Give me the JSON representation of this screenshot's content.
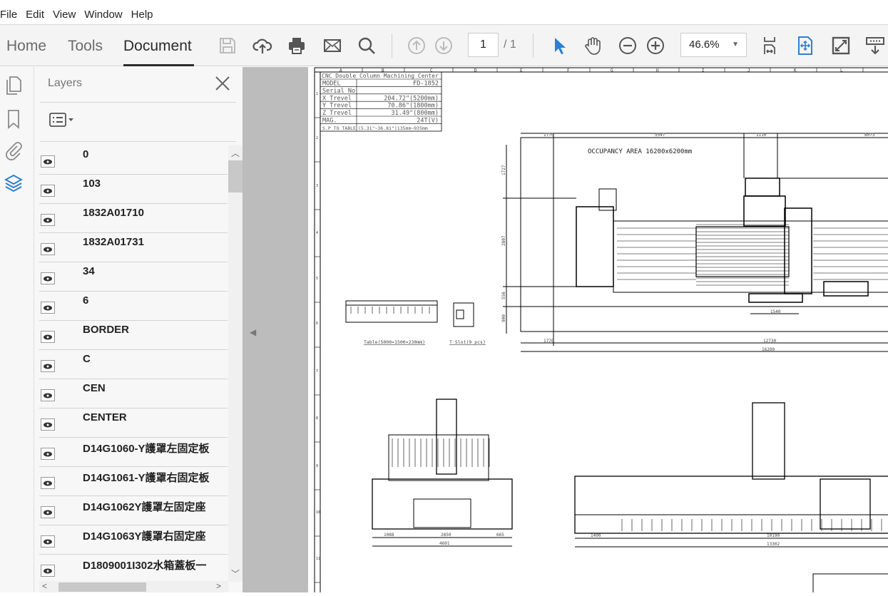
{
  "menu": [
    "File",
    "Edit",
    "View",
    "Window",
    "Help"
  ],
  "tabs": {
    "home": "Home",
    "tools": "Tools",
    "document": "Document"
  },
  "toolbar": {
    "page_current": "1",
    "page_total": "/ 1",
    "zoom": "46.6%"
  },
  "accent": "#2d7fd3",
  "layers": {
    "title": "Layers",
    "items": [
      "0",
      "103",
      "1832A01710",
      "1832A01731",
      "34",
      "6",
      "BORDER",
      "C",
      "CEN",
      "CENTER",
      "D14G1060-Y護罩左固定板",
      "D14G1061-Y護罩右固定板",
      "D14G1062Y護罩左固定座",
      "D14G1063Y護罩右固定座",
      "D1809001I302水箱蓋板一"
    ]
  },
  "drawing": {
    "col_labels": [
      "A",
      "B",
      "C",
      "D",
      "E",
      "F",
      "G",
      "H",
      "I",
      "J",
      "K",
      "L"
    ],
    "row_labels": [
      "1",
      "2",
      "3",
      "4",
      "5",
      "6",
      "7",
      "8",
      "9",
      "10",
      "11"
    ],
    "spec_table": {
      "title": "CNC Double Column Machining Center",
      "rows": [
        [
          "MODEL",
          "FD-1852"
        ],
        [
          "Serial No",
          ""
        ],
        [
          "X Trevel",
          "204.72\"(5200mm)"
        ],
        [
          "Y Trevel",
          "70.86\"(1800mm)"
        ],
        [
          "Z Trevel",
          "31.49\"(800mm)"
        ],
        [
          "MAG.",
          "24T(V)"
        ],
        [
          "S.P TO TABLE",
          "(5.31\"~36.81\")135mm~935mm"
        ]
      ]
    },
    "occupancy": "OCCUPANCY AREA 16200x6200mm",
    "top_dims": [
      "1770",
      "5547",
      "1110",
      "8073"
    ],
    "bottom_dims": [
      "1770",
      "12730",
      "16200"
    ],
    "side_dims": [
      "1727",
      "2807",
      "556",
      "900"
    ],
    "small_dim": "1540",
    "table_caption": "Table(5000×1500×230mm)",
    "tslot_caption": "T Slot(9 pcs)",
    "front_dims": [
      "1088",
      "2850",
      "665",
      "4601"
    ],
    "side_view_dims": [
      "1400",
      "10190",
      "13302"
    ]
  }
}
